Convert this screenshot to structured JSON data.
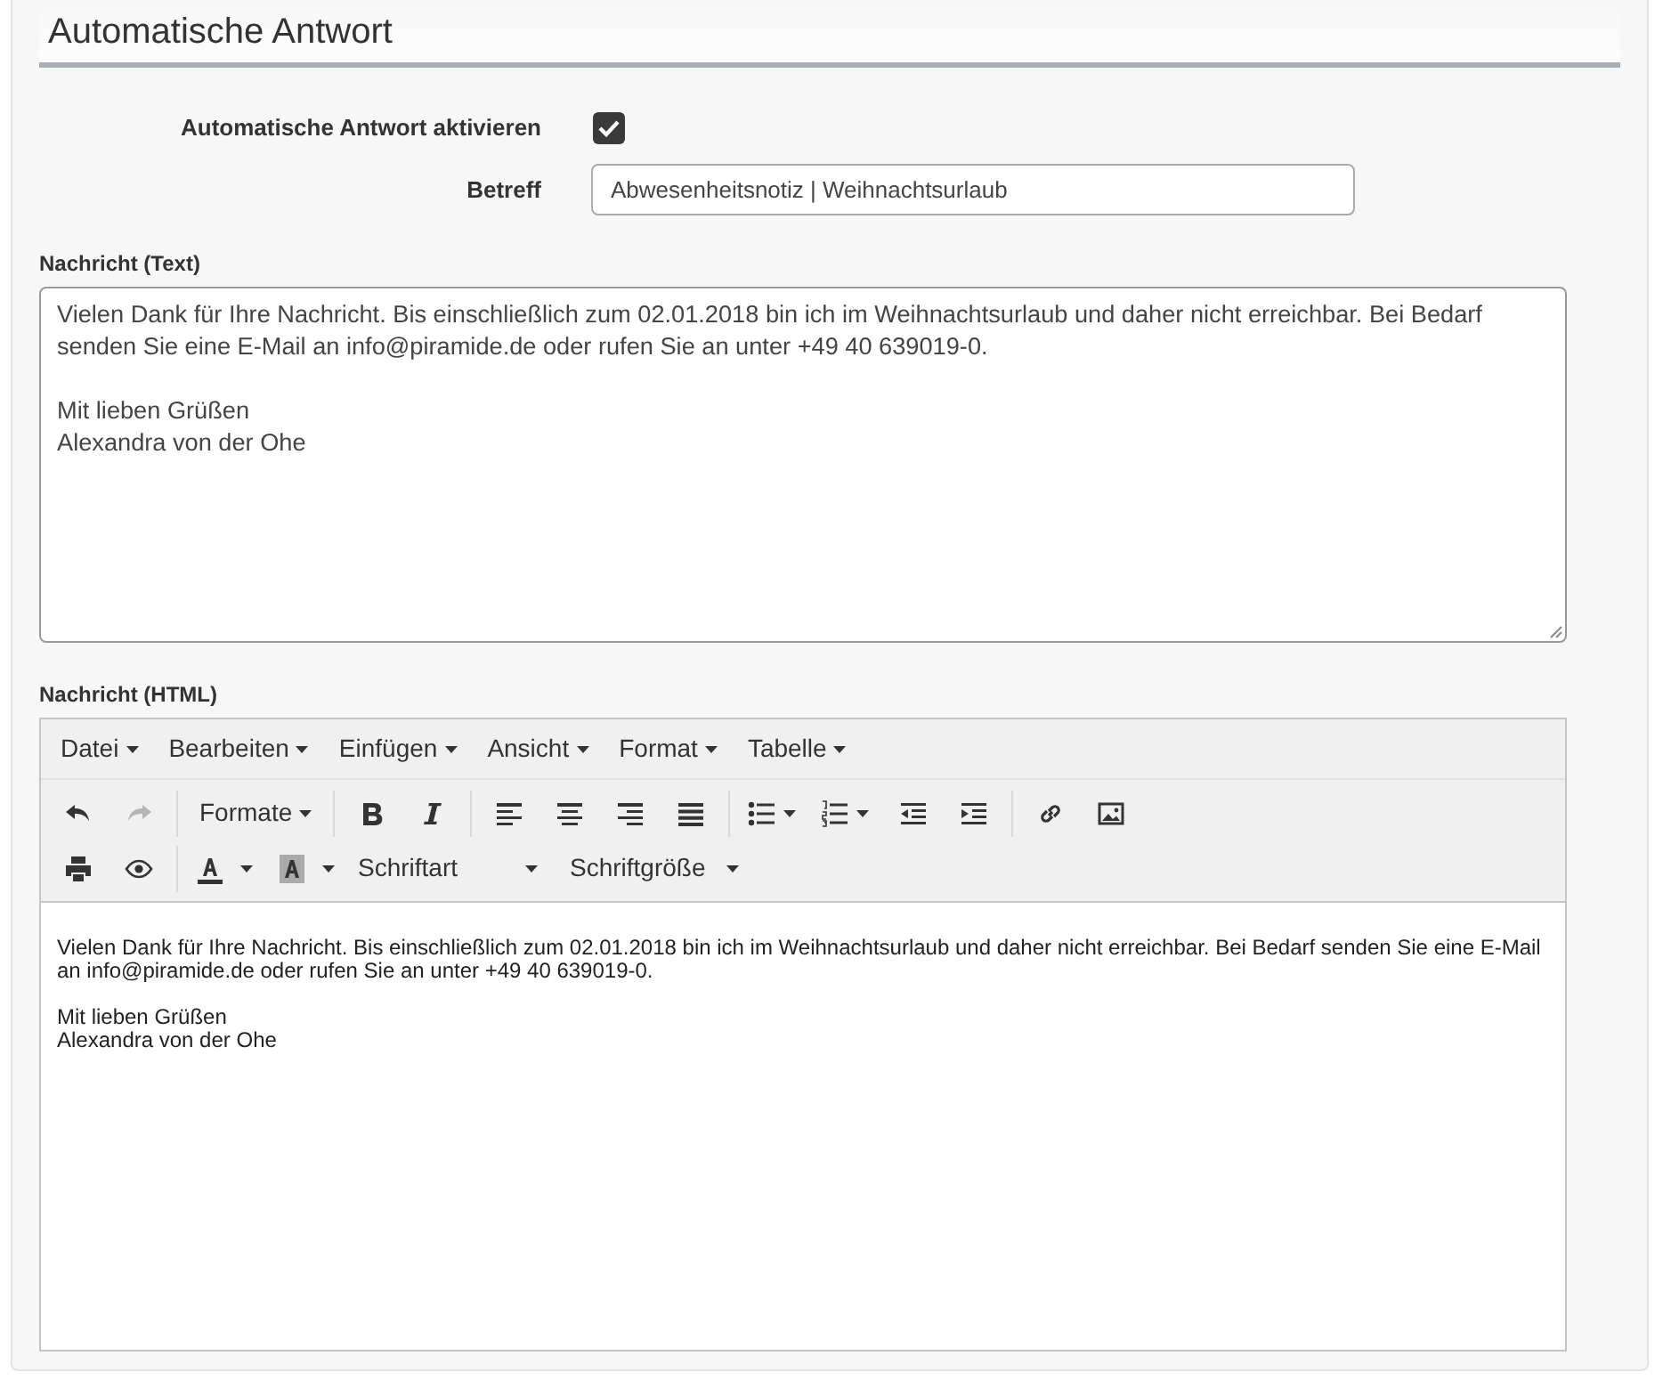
{
  "section": {
    "title": "Automatische Antwort"
  },
  "auto_reply": {
    "label": "Automatische Antwort aktivieren",
    "checked": true
  },
  "subject": {
    "label": "Betreff",
    "value": "Abwesenheitsnotiz | Weihnachtsurlaub"
  },
  "text_message": {
    "label": "Nachricht (Text)",
    "paragraphs": [
      {
        "lines": [
          "Vielen Dank für Ihre Nachricht. Bis einschließlich zum 02.01.2018 bin ich im Weihnachtsurlaub und daher nicht erreichbar. Bei Bedarf senden Sie eine E-Mail an info@piramide.de oder rufen Sie an unter +49 40 639019-0."
        ]
      },
      {
        "lines": [
          "Mit lieben Grüßen",
          "Alexandra von der Ohe"
        ]
      }
    ]
  },
  "html_message": {
    "label": "Nachricht (HTML)",
    "menus": [
      "Datei",
      "Bearbeiten",
      "Einfügen",
      "Ansicht",
      "Format",
      "Tabelle"
    ],
    "toolbar": [
      [
        {
          "kind": "undo",
          "disabled": false
        },
        {
          "kind": "redo",
          "disabled": true
        },
        {
          "kind": "sep"
        },
        {
          "kind": "dropdown",
          "label": "Formate"
        },
        {
          "kind": "sep"
        },
        {
          "kind": "bold"
        },
        {
          "kind": "italic"
        },
        {
          "kind": "sep"
        },
        {
          "kind": "align-left"
        },
        {
          "kind": "align-center"
        },
        {
          "kind": "align-right"
        },
        {
          "kind": "justify"
        },
        {
          "kind": "sep"
        },
        {
          "kind": "bullets"
        },
        {
          "kind": "numbers"
        },
        {
          "kind": "outdent"
        },
        {
          "kind": "indent"
        },
        {
          "kind": "sep"
        },
        {
          "kind": "link"
        },
        {
          "kind": "image"
        }
      ],
      [
        {
          "kind": "print"
        },
        {
          "kind": "preview"
        },
        {
          "kind": "sep"
        },
        {
          "kind": "text-color"
        },
        {
          "kind": "bg-color"
        },
        {
          "kind": "select",
          "label": "Schriftart"
        },
        {
          "kind": "select",
          "label": "Schriftgröße"
        }
      ]
    ],
    "paragraphs": [
      {
        "lines": [
          "Vielen Dank für Ihre Nachricht. Bis einschließlich zum 02.01.2018 bin ich im Weihnachtsurlaub und daher nicht erreichbar. Bei Bedarf senden Sie eine E-Mail an info@piramide.de oder rufen Sie an unter +49 40 639019-0."
        ]
      },
      {
        "lines": [
          "Mit lieben Grüßen",
          "Alexandra von der Ohe"
        ]
      }
    ]
  }
}
